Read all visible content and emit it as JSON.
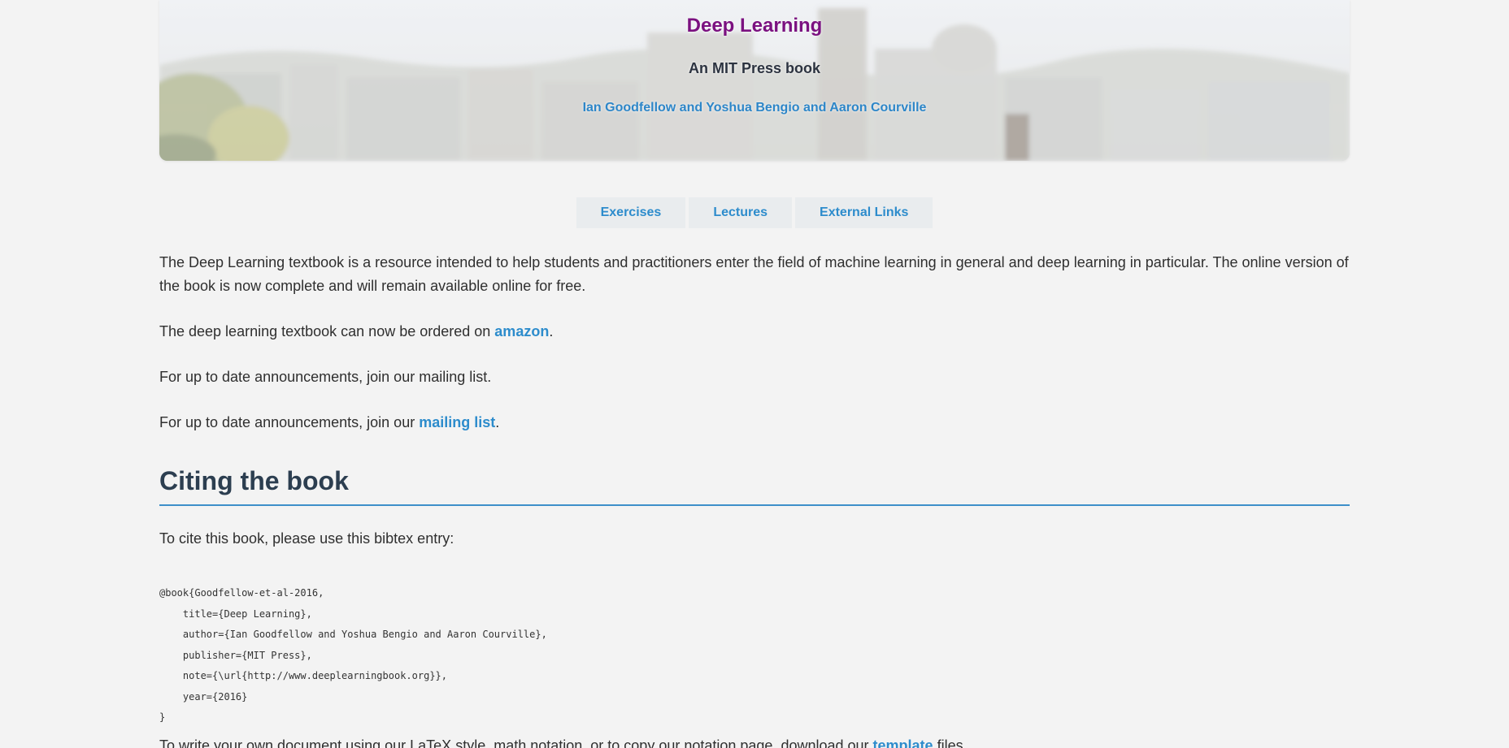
{
  "header": {
    "title": "Deep Learning",
    "subtitle": "An MIT Press book",
    "authors": "Ian Goodfellow and Yoshua Bengio and Aaron Courville"
  },
  "nav": {
    "items": [
      {
        "label": "Exercises"
      },
      {
        "label": "Lectures"
      },
      {
        "label": "External Links"
      }
    ]
  },
  "intro": {
    "text": "The Deep Learning textbook is a resource intended to help students and practitioners enter the field of machine learning in general and deep learning in particular. The online version of the book is now complete and will remain available online for free."
  },
  "order": {
    "prefix": "The deep learning textbook can now be ordered on ",
    "link": "amazon",
    "suffix": "."
  },
  "announce_plain": {
    "text": "For up to date announcements, join our mailing list."
  },
  "announce_link": {
    "prefix": "For up to date announcements, join our ",
    "link": "mailing list",
    "suffix": "."
  },
  "citing": {
    "heading": "Citing the book",
    "intro": "To cite this book, please use this bibtex entry:",
    "bibtex": "@book{Goodfellow-et-al-2016,\n    title={Deep Learning},\n    author={Ian Goodfellow and Yoshua Bengio and Aaron Courville},\n    publisher={MIT Press},\n    note={\\url{http://www.deeplearningbook.org}},\n    year={2016}\n}"
  },
  "template_line": {
    "prefix": "To write your own document using our LaTeX style, math notation, or to copy our notation page, download our ",
    "link": "template",
    "suffix": " files."
  },
  "colors": {
    "title": "#7b1180",
    "link": "#2d8ccc",
    "heading": "#2c3e50",
    "rule": "#3d8fc9",
    "page_bg": "#f3f3f3"
  }
}
